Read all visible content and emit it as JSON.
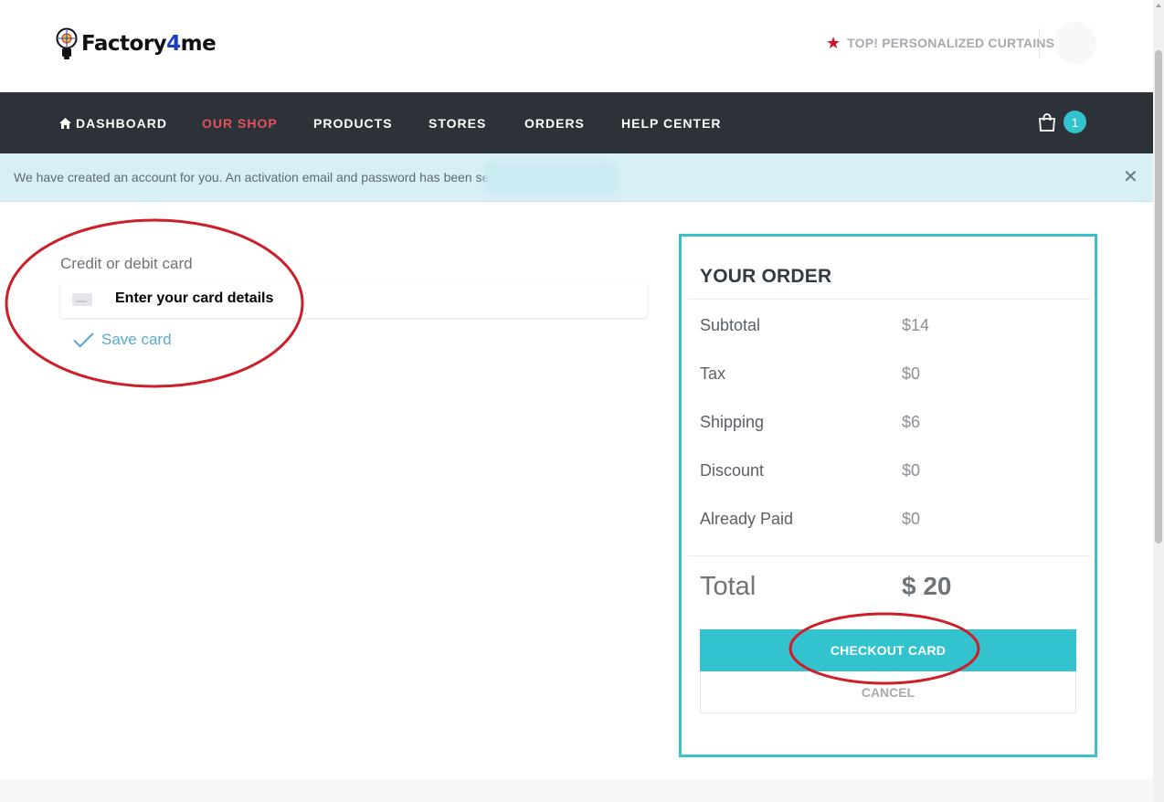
{
  "header": {
    "logo_text_a": "Factory",
    "logo_text_b": "4",
    "logo_text_c": "me",
    "promo_label": "TOP! PERSONALIZED CURTAINS"
  },
  "nav": {
    "items": [
      {
        "label": "DASHBOARD",
        "icon": "home-icon"
      },
      {
        "label": "OUR SHOP",
        "active": true
      },
      {
        "label": "PRODUCTS"
      },
      {
        "label": "STORES"
      },
      {
        "label": "ORDERS"
      },
      {
        "label": "HELP CENTER"
      }
    ],
    "cart_count": "1"
  },
  "alert": {
    "message": "We have created an account for you. An activation email and password has been sent to",
    "close_symbol": "✕"
  },
  "payment": {
    "card_label": "Credit or debit card",
    "card_placeholder": "Enter your card details",
    "save_card_label": "Save card"
  },
  "order": {
    "title": "YOUR ORDER",
    "rows": [
      {
        "label": "Subtotal",
        "value": "$14"
      },
      {
        "label": "Tax",
        "value": "$0"
      },
      {
        "label": "Shipping",
        "value": "$6"
      },
      {
        "label": "Discount",
        "value": "$0"
      },
      {
        "label": "Already Paid",
        "value": "$0"
      }
    ],
    "total_label": "Total",
    "total_value": "$ 20",
    "checkout_label": "CHECKOUT CARD",
    "cancel_label": "CANCEL"
  },
  "colors": {
    "nav_bg": "#2c3238",
    "accent": "#33c3cf",
    "active_nav": "#e8505b",
    "annotation": "#cc1f2a"
  }
}
